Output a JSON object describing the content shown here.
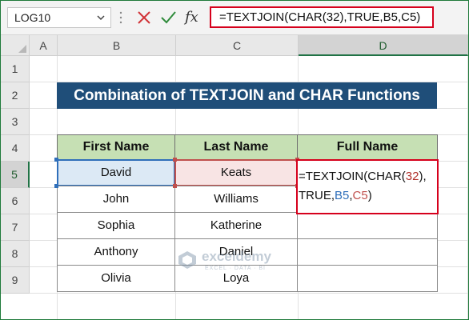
{
  "formula_bar": {
    "name_box": "LOG10",
    "fx_label": "fx",
    "formula": "=TEXTJOIN(CHAR(32),TRUE,B5,C5)"
  },
  "columns": [
    "A",
    "B",
    "C",
    "D"
  ],
  "rows": [
    "1",
    "2",
    "3",
    "4",
    "5",
    "6",
    "7",
    "8",
    "9"
  ],
  "title": "Combination of TEXTJOIN and CHAR Functions",
  "table": {
    "headers": [
      "First Name",
      "Last Name",
      "Full Name"
    ],
    "rows": [
      {
        "first": "David",
        "last": "Keats"
      },
      {
        "first": "John",
        "last": "Williams"
      },
      {
        "first": "Sophia",
        "last": "Katherine"
      },
      {
        "first": "Anthony",
        "last": "Daniel"
      },
      {
        "first": "Olivia",
        "last": "Loya"
      }
    ]
  },
  "editing_cell": {
    "line1": {
      "fn": "=TEXTJOIN(CHAR(",
      "arg": "32",
      "close": "),"
    },
    "line2": {
      "bool": "TRUE,",
      "ref1": "B5",
      "comma": ",",
      "ref2": "C5",
      "close": ")"
    }
  },
  "watermark": {
    "name": "exceldemy",
    "tagline": "EXCEL · DATA · BI"
  },
  "colors": {
    "title_bg": "#1f4e79",
    "header_bg": "#c6e0b4",
    "highlight_red": "#d6001c",
    "ref_blue": "#2f6fba",
    "ref_red": "#c0504d",
    "excel_green": "#217346"
  }
}
